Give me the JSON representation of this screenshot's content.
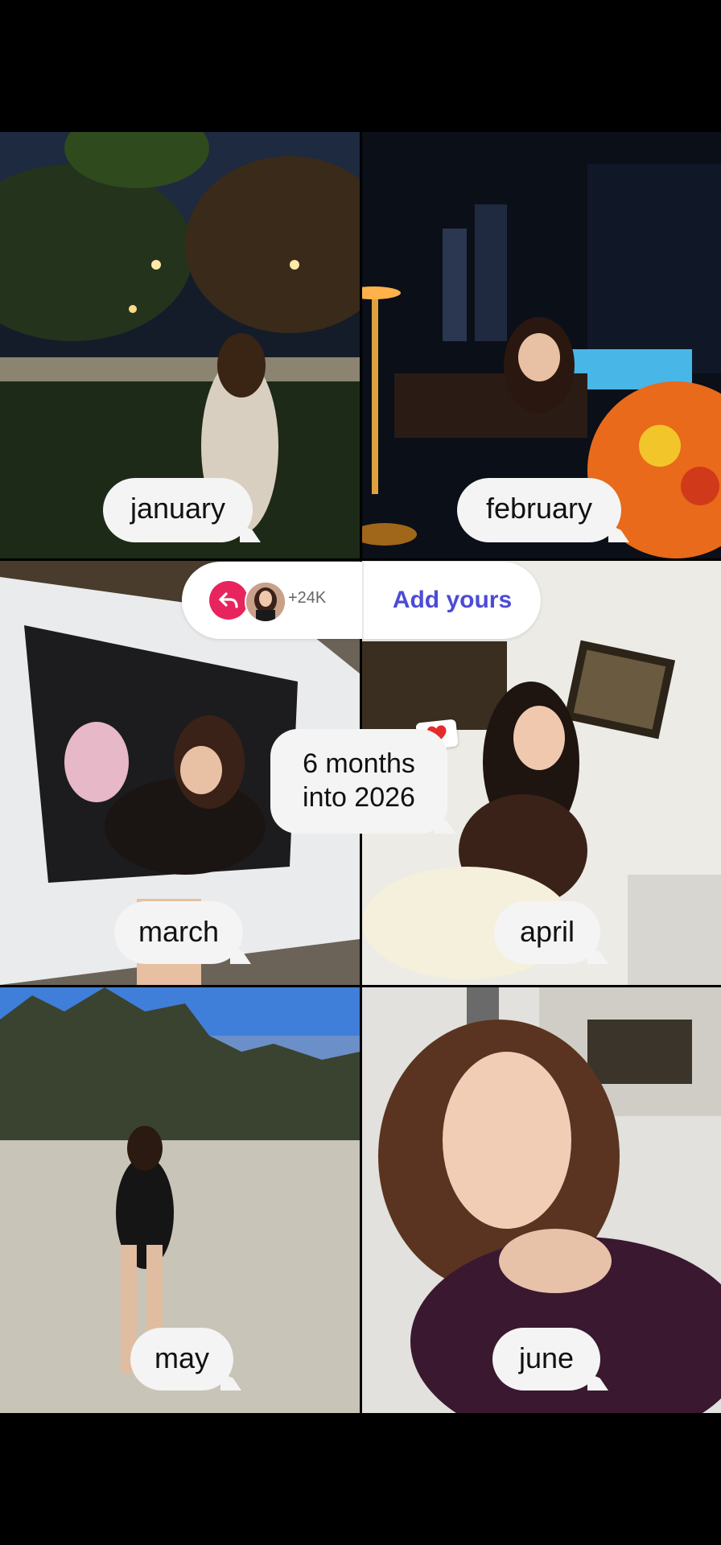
{
  "months": {
    "jan": "january",
    "feb": "february",
    "mar": "march",
    "apr": "april",
    "may": "may",
    "jun": "june"
  },
  "headline": {
    "line1": "6 months",
    "line2": "into 2026"
  },
  "add_yours": {
    "participant_count": "+24K",
    "cta_label": "Add yours"
  },
  "colors": {
    "background": "#000000",
    "bubble": "#f4f4f4",
    "reply_button": "#e8245e",
    "cta": "#4d4bd6"
  },
  "icons": {
    "reply": "reply-arrow-icon",
    "heart": "heart-icon"
  }
}
